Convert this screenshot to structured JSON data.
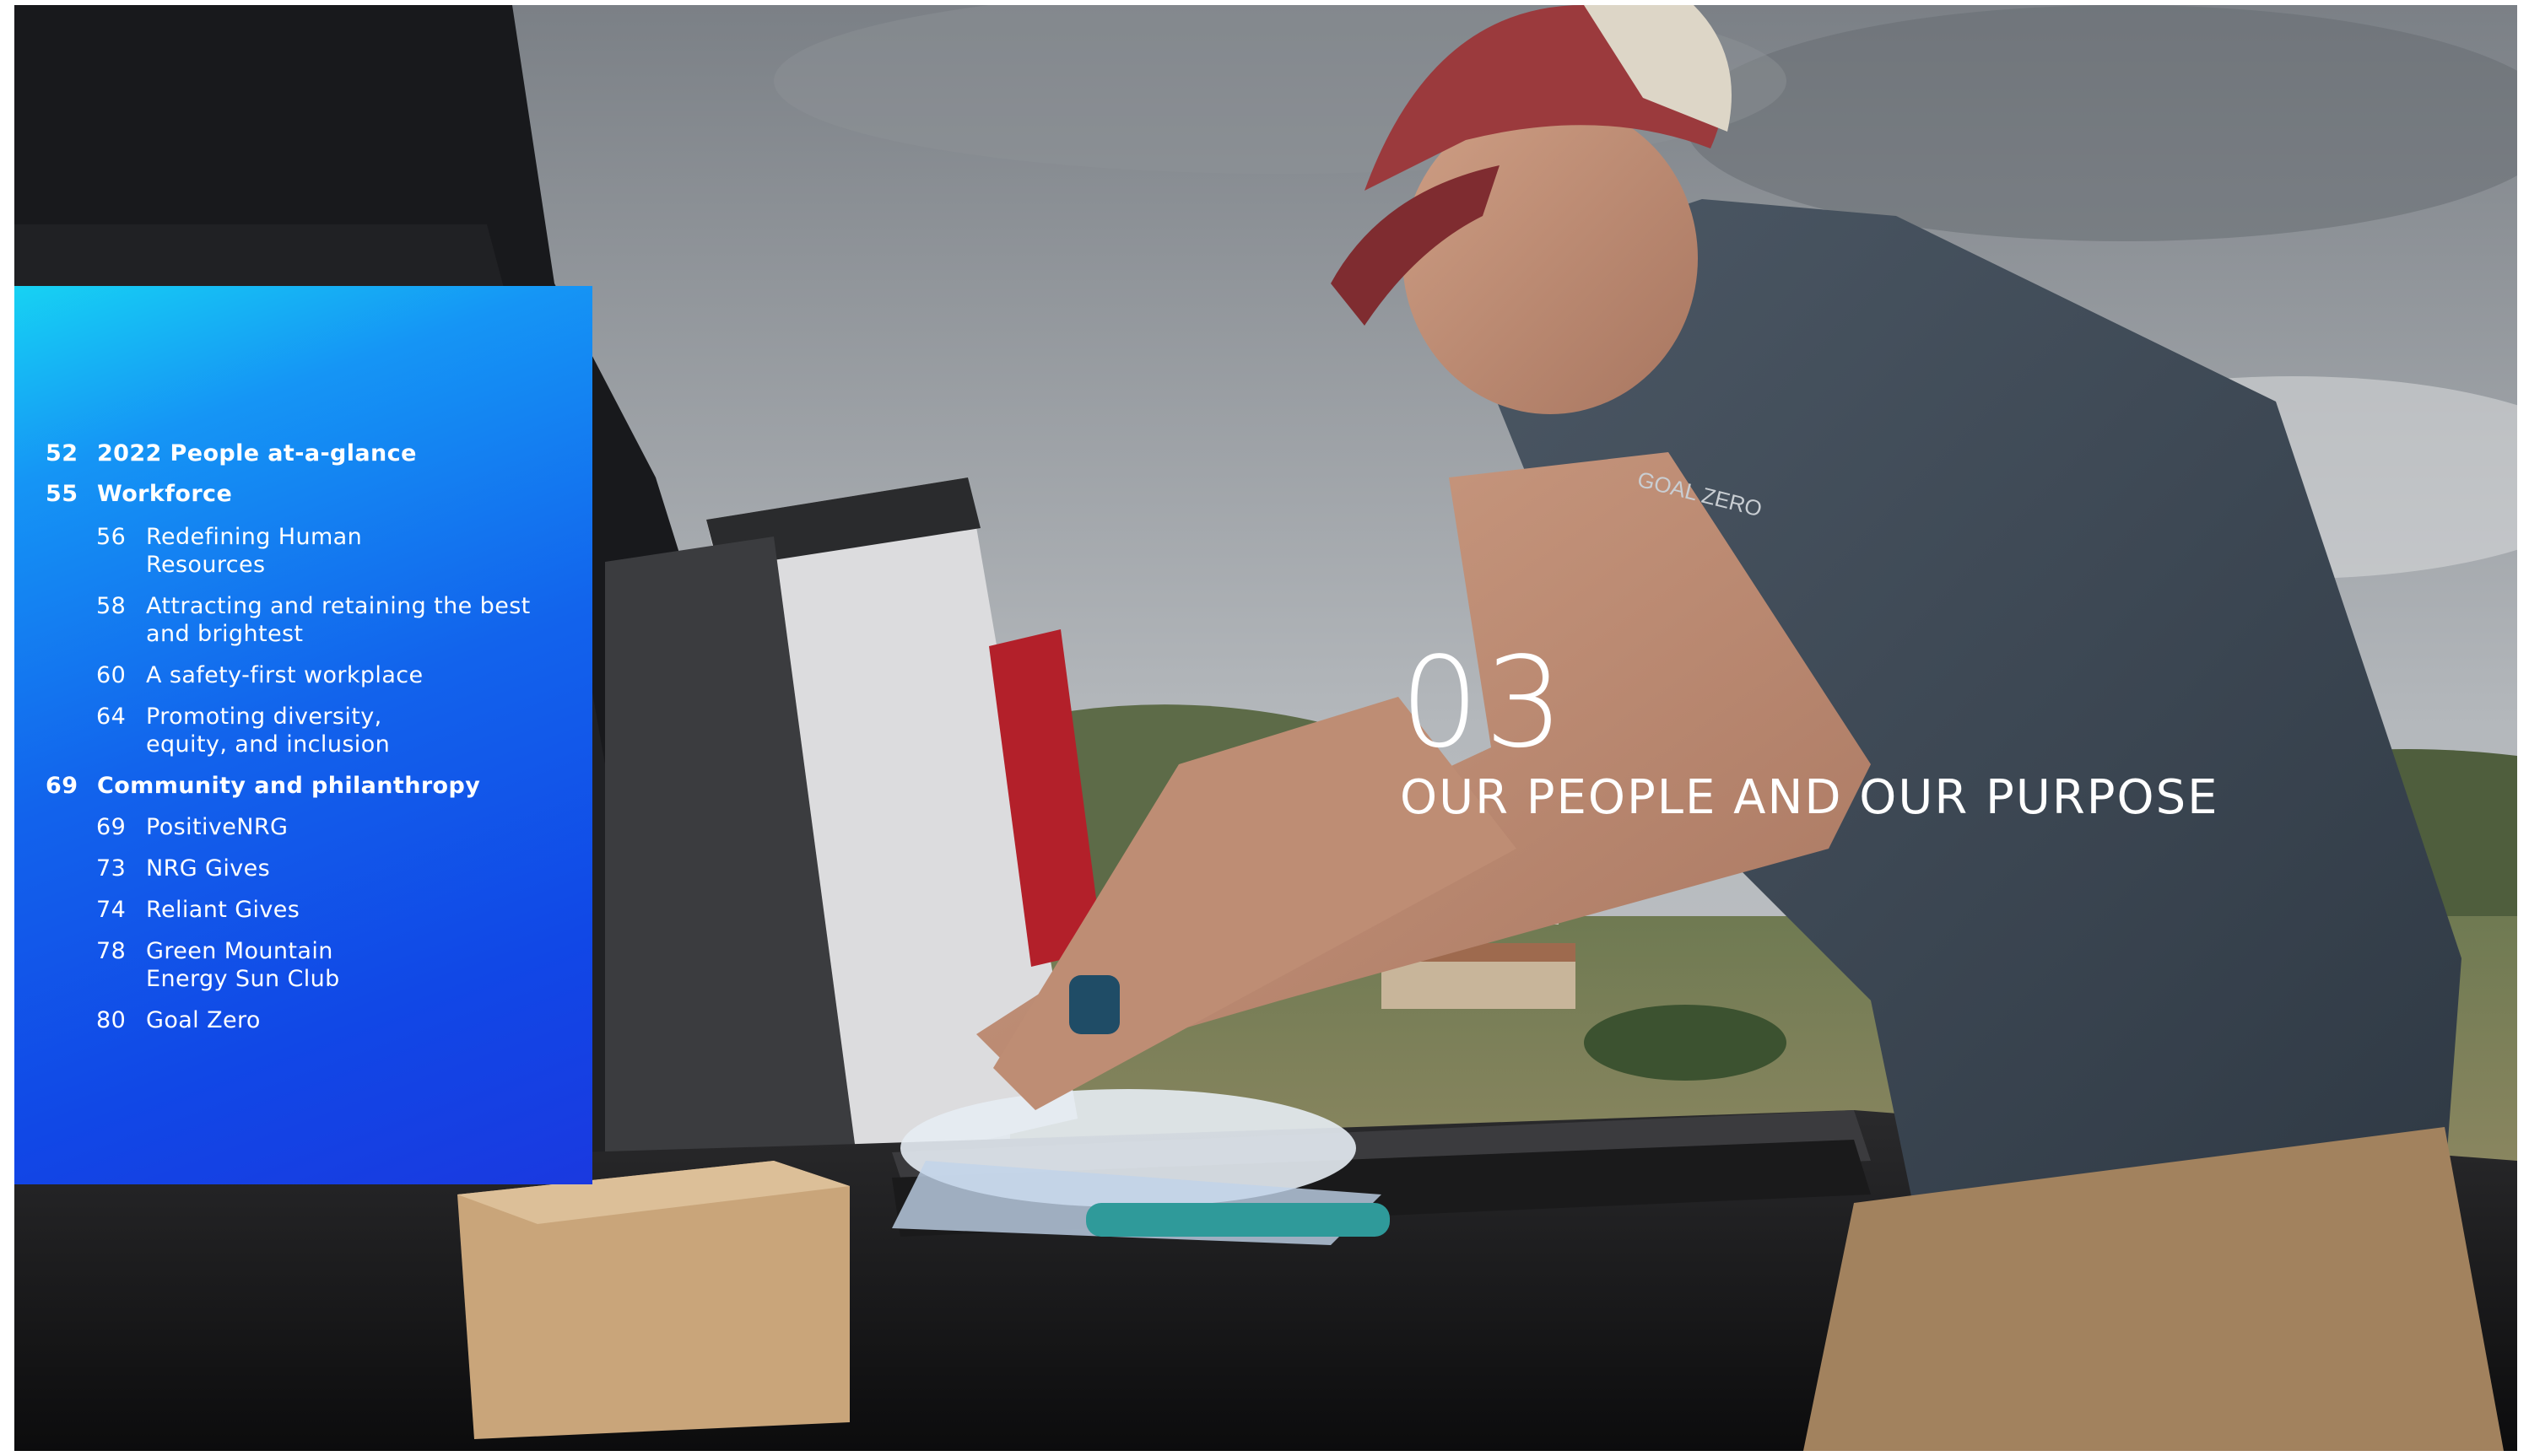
{
  "toc": [
    {
      "num": "52",
      "label": "2022 People at-a-glance",
      "level": "major"
    },
    {
      "num": "55",
      "label": "Workforce",
      "level": "major"
    },
    {
      "num": "56",
      "label": "Redefining Human\nResources",
      "level": "sub"
    },
    {
      "num": "58",
      "label": "Attracting and retaining the best\nand brightest",
      "level": "sub"
    },
    {
      "num": "60",
      "label": "A safety-first workplace",
      "level": "sub"
    },
    {
      "num": "64",
      "label": "Promoting diversity,\nequity, and inclusion",
      "level": "sub"
    },
    {
      "num": "69",
      "label": "Community and philanthropy",
      "level": "major"
    },
    {
      "num": "69",
      "label": "PositiveNRG",
      "level": "sub"
    },
    {
      "num": "73",
      "label": "NRG Gives",
      "level": "sub"
    },
    {
      "num": "74",
      "label": "Reliant Gives",
      "level": "sub"
    },
    {
      "num": "78",
      "label": "Green Mountain\nEnergy Sun Club",
      "level": "sub"
    },
    {
      "num": "80",
      "label": "Goal Zero",
      "level": "sub"
    }
  ],
  "chapter": {
    "number": "03",
    "title": "OUR PEOPLE AND OUR PURPOSE"
  },
  "photo": {
    "shirt_logo": "GOAL ZERO"
  },
  "colors": {
    "panel_top": "#17d2f3",
    "panel_bottom": "#1a39e0",
    "text": "#ffffff"
  }
}
